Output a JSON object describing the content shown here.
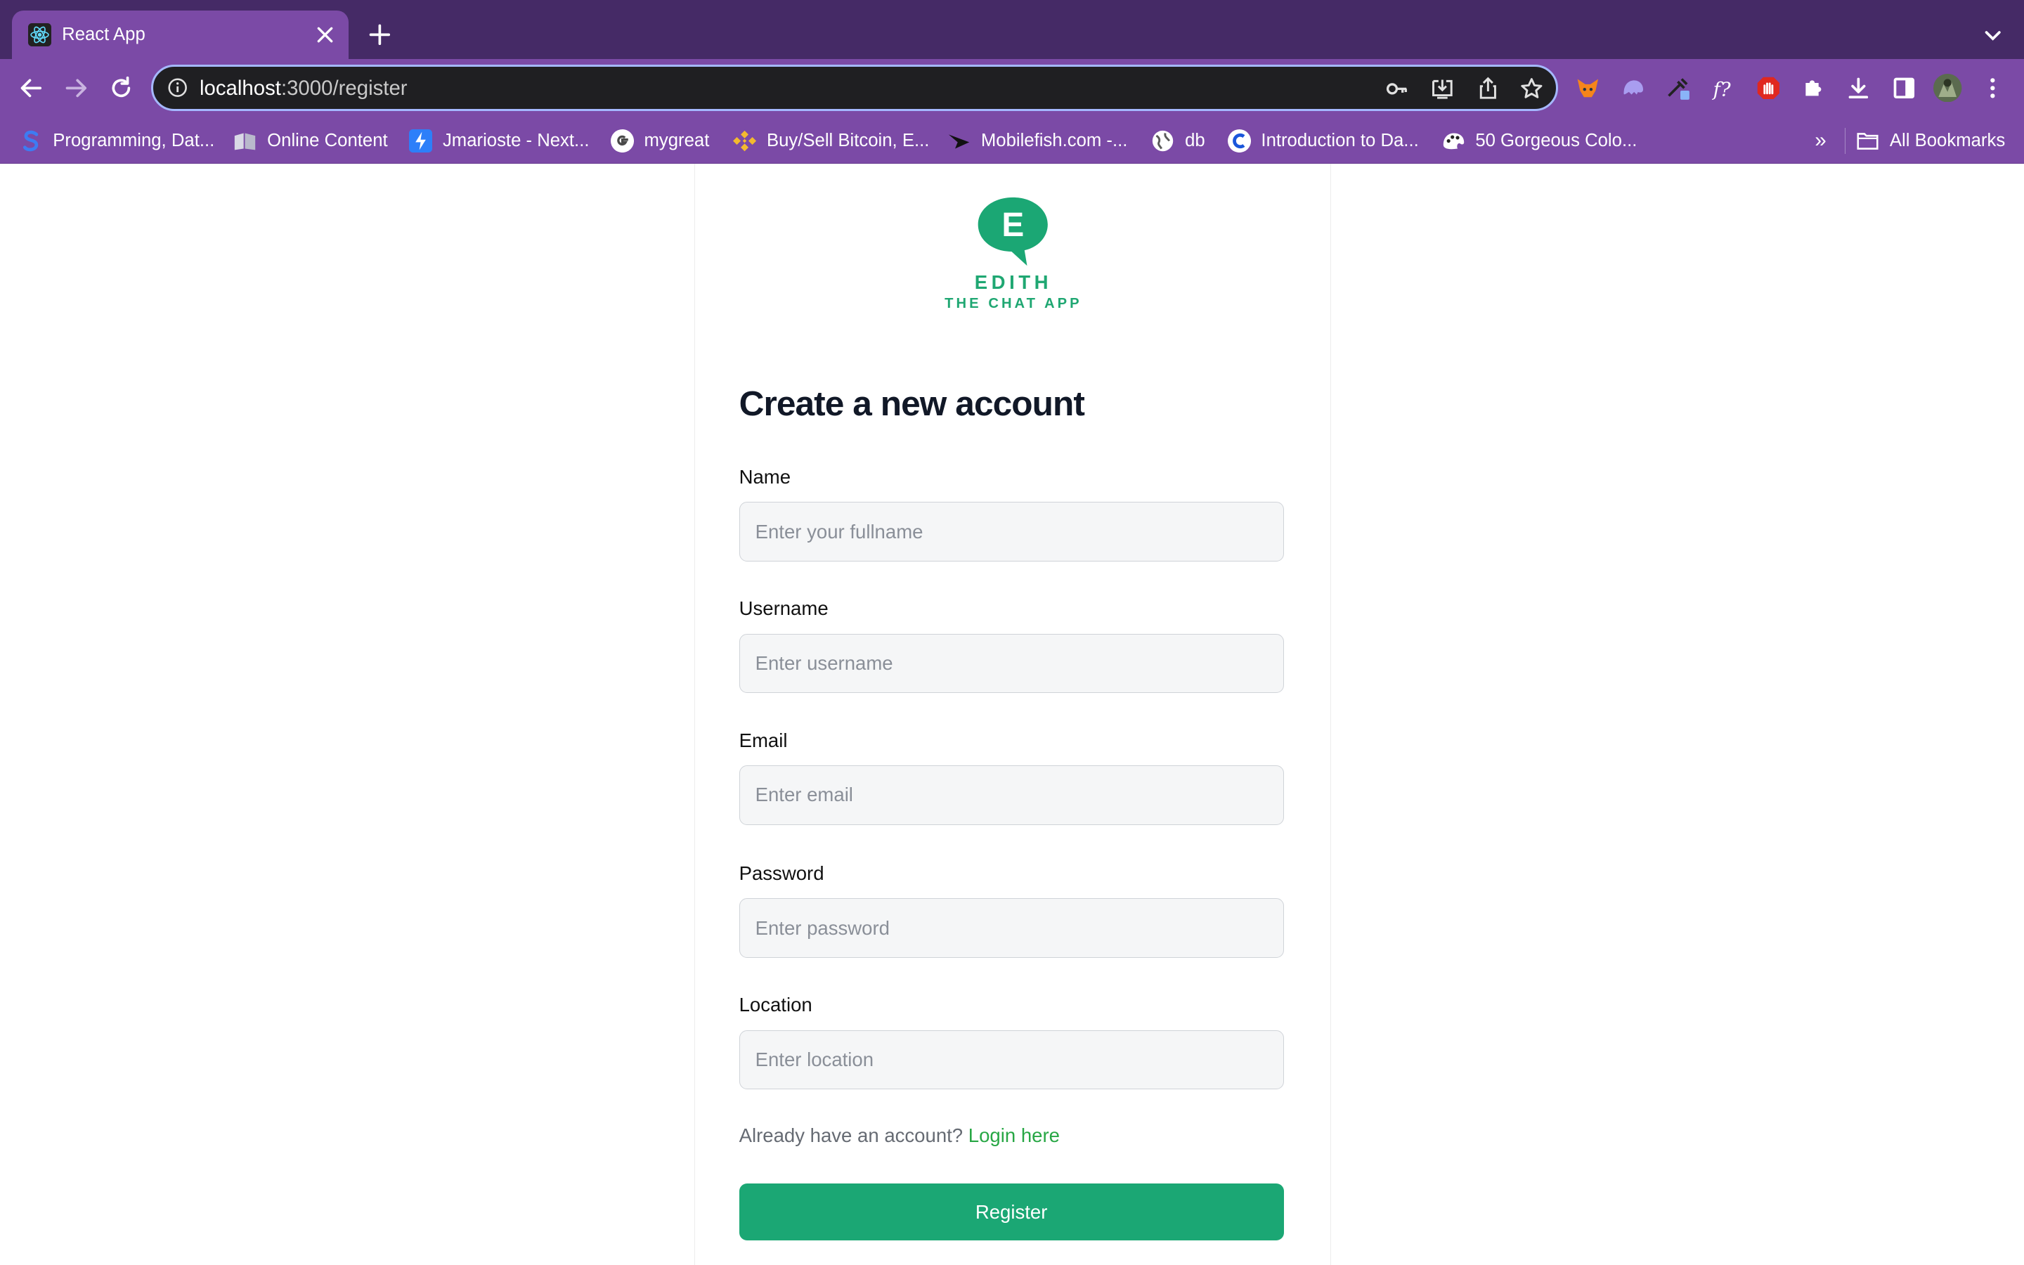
{
  "browser": {
    "tab": {
      "title": "React App"
    },
    "address": {
      "host": "localhost",
      "path": ":3000/register"
    },
    "bookmarks": [
      {
        "label": "Programming, Dat...",
        "icon": "s-logo-icon"
      },
      {
        "label": "Online Content",
        "icon": "book-icon"
      },
      {
        "label": "Jmarioste - Next...",
        "icon": "lightning-icon"
      },
      {
        "label": "mygreat",
        "icon": "google-icon"
      },
      {
        "label": "Buy/Sell Bitcoin, E...",
        "icon": "binance-icon"
      },
      {
        "label": "Mobilefish.com -...",
        "icon": "fish-icon"
      },
      {
        "label": "db",
        "icon": "globe-icon"
      },
      {
        "label": "Introduction to Da...",
        "icon": "c-logo-icon"
      },
      {
        "label": "50 Gorgeous Colo...",
        "icon": "palette-icon"
      }
    ],
    "overflow_label": "»",
    "all_bookmarks_label": "All Bookmarks"
  },
  "app": {
    "brand": "EDITH",
    "tagline": "THE CHAT APP",
    "logo_letter": "E",
    "heading": "Create a new account",
    "fields": {
      "name": {
        "label": "Name",
        "placeholder": "Enter your fullname"
      },
      "username": {
        "label": "Username",
        "placeholder": "Enter username"
      },
      "email": {
        "label": "Email",
        "placeholder": "Enter email"
      },
      "password": {
        "label": "Password",
        "placeholder": "Enter password"
      },
      "location": {
        "label": "Location",
        "placeholder": "Enter location"
      }
    },
    "login_prompt": "Already have an account?",
    "login_link": "Login here",
    "register_label": "Register"
  },
  "colors": {
    "accent": "#1ba774",
    "link": "#28a745",
    "chrome": "#7b4aa6",
    "tabstrip": "#452a66"
  }
}
